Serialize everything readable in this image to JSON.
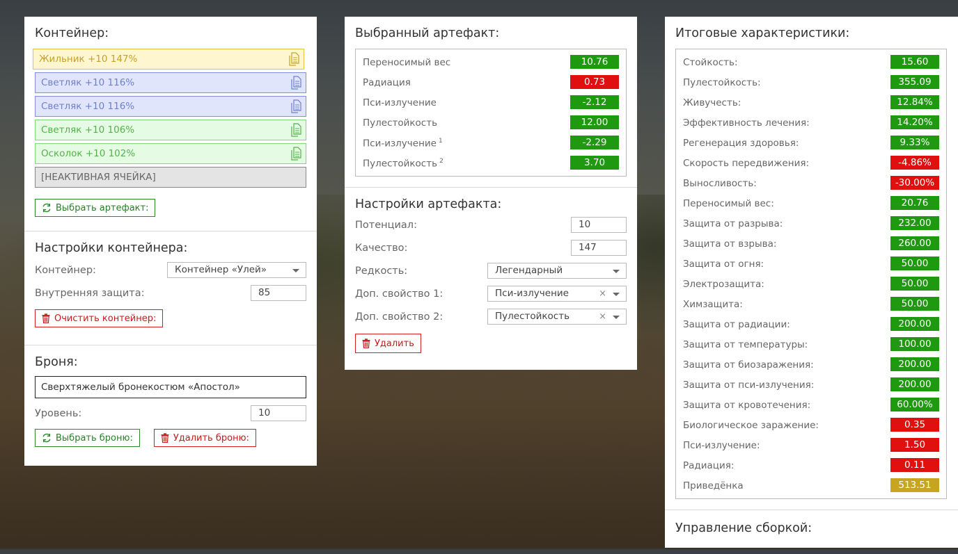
{
  "container_section": {
    "title": "Контейнер:",
    "slots": [
      {
        "label": "Жильник +10 147%",
        "color": "#c5a227"
      },
      {
        "label": "Светляк +10 116%",
        "color": "#6c7fcf"
      },
      {
        "label": "Светляк +10 116%",
        "color": "#6c7fcf"
      },
      {
        "label": "Светляк +10 106%",
        "color": "#53b24c"
      },
      {
        "label": "Осколок +10 102%",
        "color": "#53b24c"
      },
      {
        "label": "[НЕАКТИВНАЯ ЯЧЕЙКА]",
        "color": "#666666"
      }
    ],
    "select_artifact_button": "Выбрать артефакт:"
  },
  "container_settings": {
    "title": "Настройки контейнера:",
    "container_label": "Контейнер:",
    "container_value": "Контейнер «Улей»",
    "inner_protection_label": "Внутренняя защита:",
    "inner_protection_value": "85",
    "clear_button": "Очистить контейнер:"
  },
  "armor": {
    "title": "Броня:",
    "name": "Сверхтяжелый бронекостюм «Апостол»",
    "level_label": "Уровень:",
    "level_value": "10",
    "select_button": "Выбрать броню:",
    "delete_button": "Удалить броню:"
  },
  "selected_artifact": {
    "title": "Выбранный артефакт:",
    "stats": [
      {
        "name": "Переносимый вес",
        "sup": "",
        "value": "10.76",
        "tone": "g"
      },
      {
        "name": "Радиация",
        "sup": "",
        "value": "0.73",
        "tone": "r"
      },
      {
        "name": "Пси-излучение",
        "sup": "",
        "value": "-2.12",
        "tone": "g"
      },
      {
        "name": "Пулестойкость",
        "sup": "",
        "value": "12.00",
        "tone": "g"
      },
      {
        "name": "Пси-излучение",
        "sup": "1",
        "value": "-2.29",
        "tone": "g"
      },
      {
        "name": "Пулестойкость",
        "sup": "2",
        "value": "3.70",
        "tone": "g"
      }
    ]
  },
  "artifact_settings": {
    "title": "Настройки артефакта:",
    "potential_label": "Потенциал:",
    "potential_value": "10",
    "quality_label": "Качество:",
    "quality_value": "147",
    "rarity_label": "Редкость:",
    "rarity_value": "Легендарный",
    "extra1_label": "Доп. свойство 1:",
    "extra1_value": "Пси-излучение",
    "extra2_label": "Доп. свойство 2:",
    "extra2_value": "Пулестойкость",
    "clear_mark": "×",
    "delete_button": "Удалить"
  },
  "totals": {
    "title": "Итоговые характеристики:",
    "stats": [
      {
        "name": "Стойкость:",
        "value": "15.60",
        "tone": "g"
      },
      {
        "name": "Пулестойкость:",
        "value": "355.09",
        "tone": "g"
      },
      {
        "name": "Живучесть:",
        "value": "12.84%",
        "tone": "g"
      },
      {
        "name": "Эффективность лечения:",
        "value": "14.20%",
        "tone": "g"
      },
      {
        "name": "Регенерация здоровья:",
        "value": "9.33%",
        "tone": "g"
      },
      {
        "name": "Скорость передвижения:",
        "value": "-4.86%",
        "tone": "r"
      },
      {
        "name": "Выносливость:",
        "value": "-30.00%",
        "tone": "r"
      },
      {
        "name": "Переносимый вес:",
        "value": "20.76",
        "tone": "g"
      },
      {
        "name": "Защита от разрыва:",
        "value": "232.00",
        "tone": "g"
      },
      {
        "name": "Защита от взрыва:",
        "value": "260.00",
        "tone": "g"
      },
      {
        "name": "Защита от огня:",
        "value": "50.00",
        "tone": "g"
      },
      {
        "name": "Электрозащита:",
        "value": "50.00",
        "tone": "g"
      },
      {
        "name": "Химзащита:",
        "value": "50.00",
        "tone": "g"
      },
      {
        "name": "Защита от радиации:",
        "value": "200.00",
        "tone": "g"
      },
      {
        "name": "Защита от температуры:",
        "value": "100.00",
        "tone": "g"
      },
      {
        "name": "Защита от биозаражения:",
        "value": "200.00",
        "tone": "g"
      },
      {
        "name": "Защита от пси-излучения:",
        "value": "200.00",
        "tone": "g"
      },
      {
        "name": "Защита от кровотечения:",
        "value": "60.00%",
        "tone": "g"
      },
      {
        "name": "Биологическое заражение:",
        "value": "0.35",
        "tone": "r"
      },
      {
        "name": "Пси-излучение:",
        "value": "1.50",
        "tone": "r"
      },
      {
        "name": "Радиация:",
        "value": "0.11",
        "tone": "r"
      },
      {
        "name": "Приведёнка",
        "value": "513.51",
        "tone": "y"
      }
    ]
  },
  "build_management": {
    "title": "Управление сборкой:"
  },
  "icons": {
    "copy": "copy-icon",
    "refresh": "refresh-icon",
    "trash": "trash-icon",
    "dropdown": "chevron-down-icon"
  },
  "colors": {
    "green": "#1f9a10",
    "red": "#e01010",
    "gold": "#c7a521"
  }
}
